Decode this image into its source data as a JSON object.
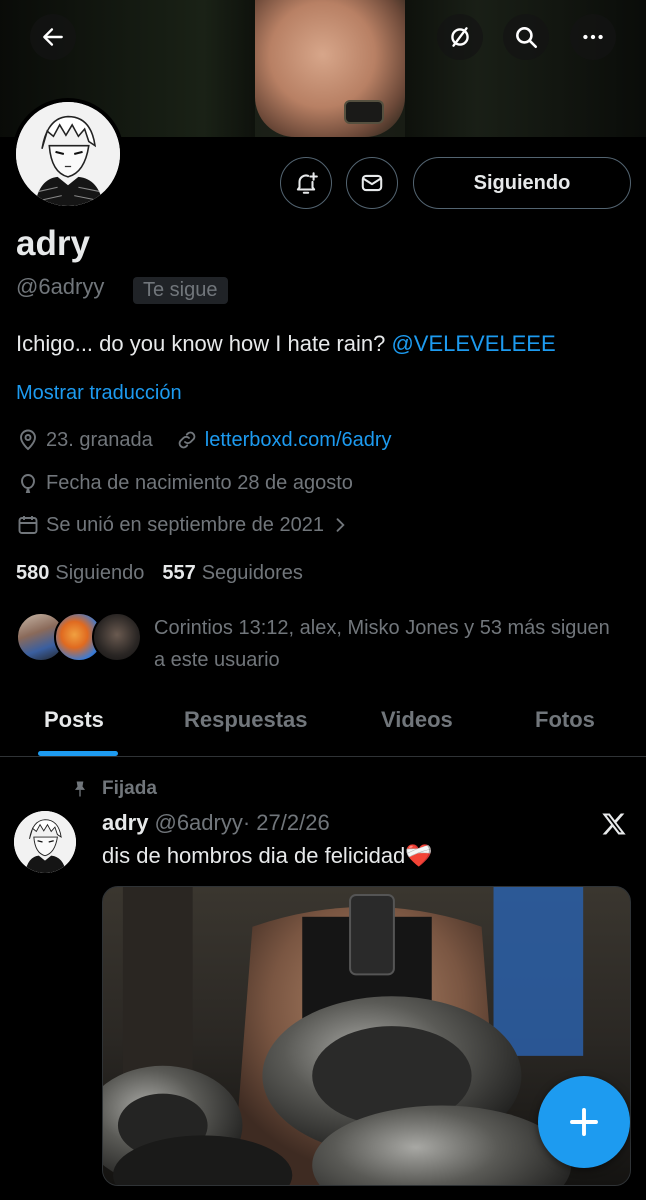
{
  "profile": {
    "name": "adry",
    "handle": "@6adryy",
    "follows_you_badge": "Te sigue",
    "bio_text": "Ichigo... do you know how I hate rain? ",
    "bio_mention": "@VELEVELEEE",
    "translate_label": "Mostrar traducción",
    "location": "23. granada",
    "website": "letterboxd.com/6adry",
    "birthday": "Fecha de nacimiento 28 de agosto",
    "joined": "Se unió en septiembre de 2021",
    "following_count": "580",
    "following_label": "Siguiendo",
    "followers_count": "557",
    "followers_label": "Seguidores",
    "mutuals_text": "Corintios 13:12, alex, Misko Jones y 53 más siguen a este usuario"
  },
  "actions": {
    "follow_button_label": "Siguiendo",
    "notify_icon": "bell-plus-icon",
    "message_icon": "envelope-icon"
  },
  "topbar": {
    "back_icon": "arrow-left-icon",
    "grok_icon": "grok-icon",
    "search_icon": "search-icon",
    "more_icon": "more-icon"
  },
  "tabs": [
    {
      "label": "Posts",
      "active": true
    },
    {
      "label": "Respuestas",
      "active": false
    },
    {
      "label": "Videos",
      "active": false
    },
    {
      "label": "Fotos",
      "active": false
    }
  ],
  "pinned_post": {
    "pinned_label": "Fijada",
    "author_name": "adry",
    "author_handle": "@6adryy",
    "date": "· 27/2/26",
    "text": "dis de hombros dia de felicidad",
    "emoji": "❤️‍🩹"
  },
  "colors": {
    "accent": "#1d9bf0",
    "background": "#000000",
    "secondary_text": "#71767b",
    "border": "#536471"
  }
}
